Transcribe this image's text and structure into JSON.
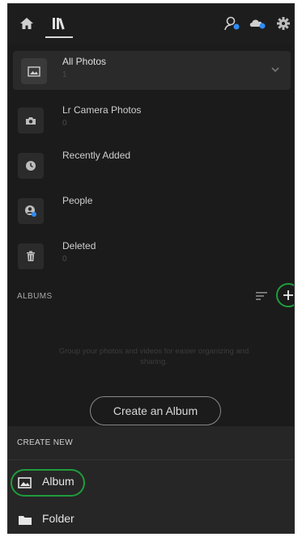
{
  "colors": {
    "background": "#1b1b1b",
    "highlight_ring": "#1f9c3c",
    "sync_badge": "#2f8df2"
  },
  "topbar": {
    "home_icon": "home-icon",
    "library_icon": "library-icon",
    "search_people_icon": "search-person-icon",
    "cloud_icon": "cloud-sync-icon",
    "settings_icon": "gear-icon"
  },
  "library": {
    "items": [
      {
        "label": "All Photos",
        "count": "1",
        "icon": "photo-icon"
      },
      {
        "label": "Lr Camera Photos",
        "count": "0",
        "icon": "camera-icon"
      },
      {
        "label": "Recently Added",
        "count": "",
        "icon": "clock-icon"
      },
      {
        "label": "People",
        "count": "",
        "icon": "people-icon"
      },
      {
        "label": "Deleted",
        "count": "0",
        "icon": "trash-icon"
      }
    ]
  },
  "albums": {
    "heading": "ALBUMS",
    "empty_message": "Group your photos and videos for easier organizing and sharing.",
    "create_button": "Create an Album"
  },
  "create_new": {
    "title": "CREATE NEW",
    "items": [
      {
        "label": "Album",
        "icon": "album-icon"
      },
      {
        "label": "Folder",
        "icon": "folder-icon"
      }
    ]
  }
}
